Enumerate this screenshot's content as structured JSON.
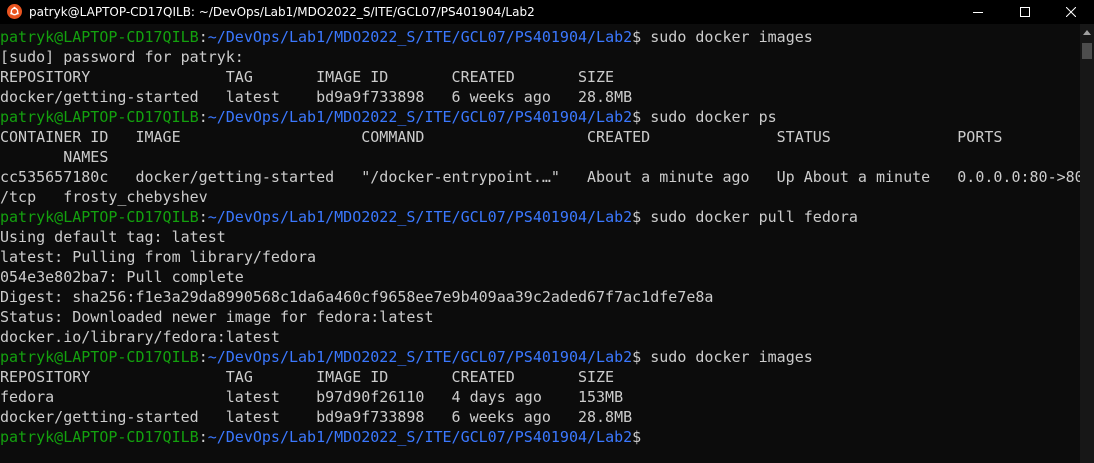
{
  "window": {
    "title": "patryk@LAPTOP-CD17QILB: ~/DevOps/Lab1/MDO2022_S/ITE/GCL07/PS401904/Lab2",
    "app_icon": "ubuntu-icon",
    "controls": [
      "minimize-icon",
      "maximize-icon",
      "close-icon"
    ]
  },
  "colors": {
    "background": "#0c0c0c",
    "text": "#cccccc",
    "prompt_user": "#13a10e",
    "prompt_path": "#3b78ff"
  },
  "prompt": {
    "user_host": "patryk@LAPTOP-CD17QILB",
    "separator": ":",
    "path": "~/DevOps/Lab1/MDO2022_S/ITE/GCL07/PS401904/Lab2",
    "symbol": "$"
  },
  "lines": [
    {
      "type": "prompt",
      "command": " sudo docker images"
    },
    {
      "type": "output",
      "text": "[sudo] password for patryk:"
    },
    {
      "type": "output",
      "text": "REPOSITORY               TAG       IMAGE ID       CREATED       SIZE"
    },
    {
      "type": "output",
      "text": "docker/getting-started   latest    bd9a9f733898   6 weeks ago   28.8MB"
    },
    {
      "type": "prompt",
      "command": " sudo docker ps"
    },
    {
      "type": "output",
      "text": "CONTAINER ID   IMAGE                    COMMAND                  CREATED              STATUS              PORTS"
    },
    {
      "type": "output",
      "text": "       NAMES"
    },
    {
      "type": "output",
      "text": "cc535657180c   docker/getting-started   \"/docker-entrypoint.…\"   About a minute ago   Up About a minute   0.0.0.0:80->80"
    },
    {
      "type": "output",
      "text": "/tcp   frosty_chebyshev"
    },
    {
      "type": "prompt",
      "command": " sudo docker pull fedora"
    },
    {
      "type": "output",
      "text": "Using default tag: latest"
    },
    {
      "type": "output",
      "text": "latest: Pulling from library/fedora"
    },
    {
      "type": "output",
      "text": "054e3e802ba7: Pull complete"
    },
    {
      "type": "output",
      "text": "Digest: sha256:f1e3a29da8990568c1da6a460cf9658ee7e9b409aa39c2aded67f7ac1dfe7e8a"
    },
    {
      "type": "output",
      "text": "Status: Downloaded newer image for fedora:latest"
    },
    {
      "type": "output",
      "text": "docker.io/library/fedora:latest"
    },
    {
      "type": "prompt",
      "command": " sudo docker images"
    },
    {
      "type": "output",
      "text": "REPOSITORY               TAG       IMAGE ID       CREATED       SIZE"
    },
    {
      "type": "output",
      "text": "fedora                   latest    b97d90f26110   4 days ago    153MB"
    },
    {
      "type": "output",
      "text": "docker/getting-started   latest    bd9a9f733898   6 weeks ago   28.8MB"
    },
    {
      "type": "prompt",
      "command": ""
    }
  ]
}
